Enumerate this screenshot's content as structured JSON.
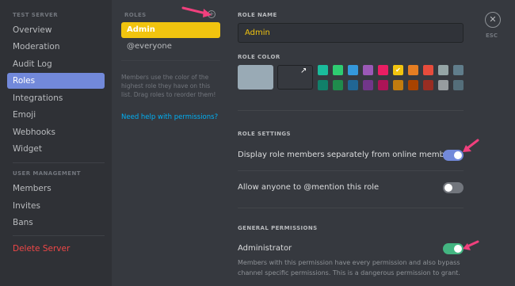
{
  "sidebar": {
    "server_header": "TEST SERVER",
    "items": [
      {
        "label": "Overview"
      },
      {
        "label": "Moderation"
      },
      {
        "label": "Audit Log"
      },
      {
        "label": "Roles"
      },
      {
        "label": "Integrations"
      },
      {
        "label": "Emoji"
      },
      {
        "label": "Webhooks"
      },
      {
        "label": "Widget"
      }
    ],
    "user_header": "USER MANAGEMENT",
    "user_items": [
      {
        "label": "Members"
      },
      {
        "label": "Invites"
      },
      {
        "label": "Bans"
      }
    ],
    "delete_label": "Delete Server",
    "active_item": "Roles"
  },
  "roles": {
    "header": "ROLES",
    "add_icon": "plus-circle-icon",
    "list": [
      {
        "label": "Admin",
        "color": "#f1c40f"
      },
      {
        "label": "@everyone"
      }
    ],
    "help_text": "Members use the color of the highest role they have on this list. Drag roles to reorder them!",
    "help_link": "Need help with permissions?"
  },
  "main": {
    "role_name_label": "ROLE NAME",
    "role_name_value": "Admin",
    "role_color_label": "ROLE COLOR",
    "default_color": "#99aab5",
    "selected_color": "#f1c40f",
    "swatches_top": [
      "#1abc9c",
      "#2ecc71",
      "#3498db",
      "#9b59b6",
      "#e91e63",
      "#f1c40f",
      "#e67e22",
      "#e74c3c",
      "#95a5a6",
      "#607d8b"
    ],
    "swatches_bottom": [
      "#11806a",
      "#1f8b4c",
      "#206694",
      "#71368a",
      "#ad1457",
      "#c27c0e",
      "#a84300",
      "#992d22",
      "#979c9f",
      "#546e7a"
    ],
    "role_settings_label": "ROLE SETTINGS",
    "settings": [
      {
        "label": "Display role members separately from online members",
        "enabled": true
      },
      {
        "label": "Allow anyone to @mention this role",
        "enabled": false
      }
    ],
    "general_permissions_label": "GENERAL PERMISSIONS",
    "permissions": [
      {
        "label": "Administrator",
        "enabled": true,
        "description": "Members with this permission have every permission and also bypass channel specific permissions. This is a dangerous permission to grant."
      }
    ]
  },
  "close": {
    "icon": "close-icon",
    "label": "ESC"
  },
  "colors": {
    "accent": "#7289da",
    "toggle_on_blue": "#7289da",
    "toggle_on_green": "#43b581",
    "toggle_off": "#72767d",
    "danger": "#f04747",
    "link": "#00b0f4",
    "annotation_arrow": "#f0407d"
  }
}
